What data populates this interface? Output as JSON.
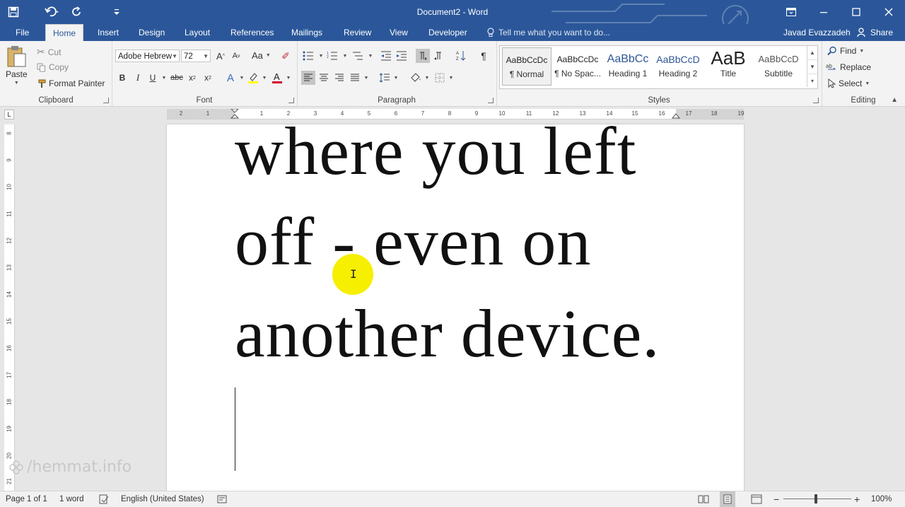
{
  "app": {
    "doc_title": "Document2 - Word",
    "accent": "#2b579a"
  },
  "qat": {
    "icons": [
      "save-icon",
      "undo-icon",
      "redo-icon",
      "customize-icon"
    ]
  },
  "tabs": [
    "File",
    "Home",
    "Insert",
    "Design",
    "Layout",
    "References",
    "Mailings",
    "Review",
    "View",
    "Developer"
  ],
  "active_tab": "Home",
  "tell_me": "Tell me what you want to do...",
  "user": "Javad Evazzadeh",
  "share": "Share",
  "clipboard": {
    "label": "Clipboard",
    "paste": "Paste",
    "cut": "Cut",
    "copy": "Copy",
    "format_painter": "Format Painter"
  },
  "font": {
    "label": "Font",
    "family": "Adobe Hebrew",
    "size": "72",
    "case_label": "Aa"
  },
  "paragraph": {
    "label": "Paragraph"
  },
  "styles": {
    "label": "Styles",
    "items": [
      {
        "preview": "AaBbCcDc",
        "name": "¶ Normal"
      },
      {
        "preview": "AaBbCcDc",
        "name": "¶ No Spac..."
      },
      {
        "preview": "AaBbCc",
        "name": "Heading 1"
      },
      {
        "preview": "AaBbCcD",
        "name": "Heading 2"
      },
      {
        "preview": "AaB",
        "name": "Title"
      },
      {
        "preview": "AaBbCcD",
        "name": "Subtitle"
      }
    ]
  },
  "editing": {
    "label": "Editing",
    "find": "Find",
    "replace": "Replace",
    "select": "Select"
  },
  "ruler": {
    "h_ticks": [
      "2",
      "1",
      "1",
      "2",
      "3",
      "4",
      "5",
      "6",
      "7",
      "8",
      "9",
      "10",
      "11",
      "12",
      "13",
      "14",
      "15",
      "16",
      "17",
      "18",
      "19"
    ],
    "v_ticks": [
      "8",
      "9",
      "10",
      "11",
      "12",
      "13",
      "14",
      "15",
      "16",
      "17",
      "18",
      "19",
      "20",
      "21"
    ],
    "corner": "L"
  },
  "document": {
    "lines": [
      "where you left",
      "off - even on",
      "another device."
    ]
  },
  "watermark": "/hemmat.info",
  "status": {
    "page": "Page 1 of 1",
    "words": "1 word",
    "language": "English (United States)",
    "zoom": "100%"
  }
}
